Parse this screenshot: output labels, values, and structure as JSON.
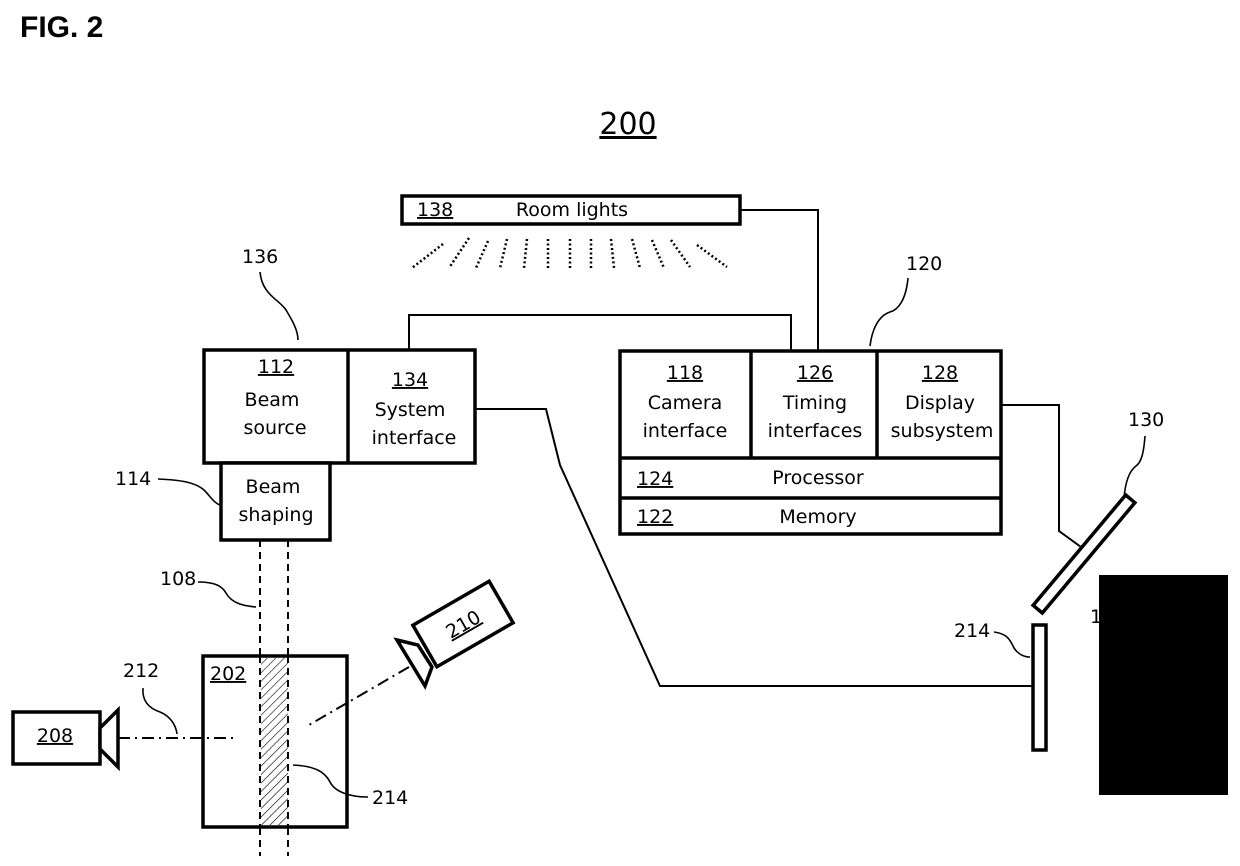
{
  "figure": {
    "label": "FIG. 2",
    "system_number": "200"
  },
  "room_lights": {
    "ref": "138",
    "label": "Room lights"
  },
  "beam_unit": {
    "ref": "136",
    "beam_source": {
      "ref": "112",
      "line1": "Beam",
      "line2": "source"
    },
    "system_interface": {
      "ref": "134",
      "line1": "System",
      "line2": "interface"
    },
    "beam_shaping": {
      "ref": "114",
      "line1": "Beam",
      "line2": "shaping"
    }
  },
  "controller": {
    "ref": "120",
    "camera_interface": {
      "ref": "118",
      "line1": "Camera",
      "line2": "interface"
    },
    "timing_interfaces": {
      "ref": "126",
      "line1": "Timing",
      "line2": "interfaces"
    },
    "display_subsystem": {
      "ref": "128",
      "line1": "Display",
      "line2": "subsystem"
    },
    "processor": {
      "ref": "124",
      "label": "Processor"
    },
    "memory": {
      "ref": "122",
      "label": "Memory"
    }
  },
  "beam_ref": "108",
  "sample": {
    "ref": "202",
    "sheet_ref": "214"
  },
  "camera_left": {
    "ref": "208",
    "axis_ref": "212"
  },
  "camera_right": {
    "ref": "210"
  },
  "display_ref": "130",
  "screen_ref": "214",
  "occluded_label_fragment": "1"
}
